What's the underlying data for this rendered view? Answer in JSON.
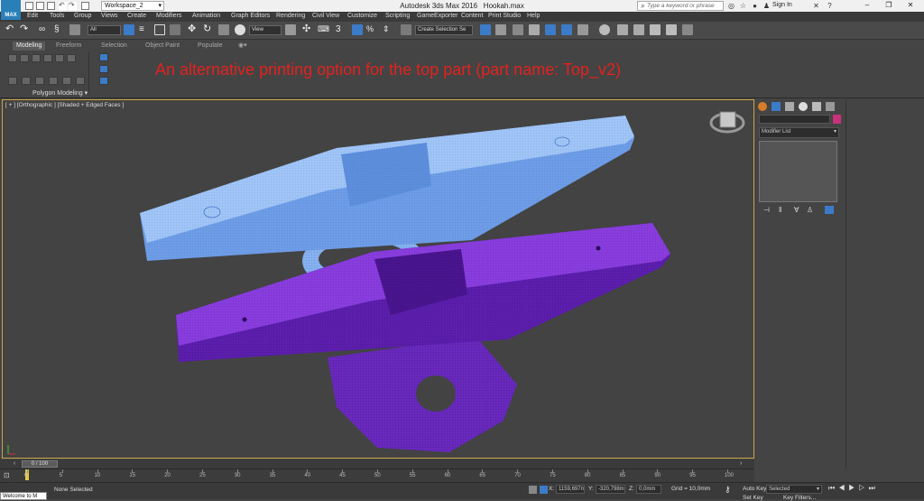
{
  "titlebar": {
    "app_icon_label": "MAX",
    "workspace": "Workspace_2",
    "app_title": "Autodesk 3ds Max 2016",
    "file_name": "Hookah.max",
    "search_placeholder": "Type a keyword or phrase",
    "signin": "Sign In"
  },
  "menu": [
    "Edit",
    "Tools",
    "Group",
    "Views",
    "Create",
    "Modifiers",
    "Animation",
    "Graph Editors",
    "Rendering",
    "Civil View",
    "Customize",
    "Scripting",
    "GameExporter",
    "Content",
    "Print Studio",
    "Help"
  ],
  "toolbar": {
    "filter_value": "All",
    "refcoord_value": "View",
    "snap_value": "3",
    "selection_set_placeholder": "Create Selection Se"
  },
  "ribbon": {
    "tabs": [
      "Modeling",
      "Freeform",
      "Selection",
      "Object Paint",
      "Populate"
    ],
    "active_tab": "Modeling",
    "panel_label": "Polygon Modeling",
    "annotation": "An alternative printing option for the top part (part name: Top_v2)"
  },
  "viewport": {
    "label": "[ + ] [Orthographic ] [Shaded + Edged Faces ]",
    "colors": {
      "top_part": "#8db8f0",
      "bottom_part": "#7a2fd0",
      "border": "#c9a64a"
    }
  },
  "command_panel": {
    "modifier_list": "Modifier List",
    "color_swatch": "#c8327a"
  },
  "timeline": {
    "frame_counter": "0 / 100",
    "ticks": [
      "0",
      "5",
      "10",
      "15",
      "20",
      "25",
      "30",
      "35",
      "40",
      "45",
      "50",
      "55",
      "60",
      "65",
      "70",
      "75",
      "80",
      "85",
      "90",
      "95",
      "100"
    ]
  },
  "status": {
    "script_listener": "Welcome to M",
    "selected_text": "None Selected",
    "x_value": "1159,697m",
    "y_value": "-320,798m",
    "z_value": "0,0mm",
    "grid": "Grid = 10,0mm",
    "auto_key": "Auto Key",
    "set_key": "Set Key",
    "key_mode": "Selected",
    "key_filters": "Key Filters..."
  }
}
